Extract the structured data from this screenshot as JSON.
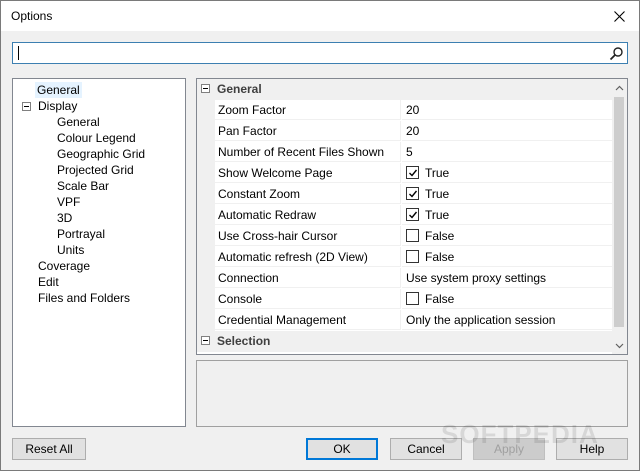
{
  "window": {
    "title": "Options"
  },
  "search": {
    "value": "",
    "placeholder": ""
  },
  "tree": {
    "items": [
      {
        "label": "General",
        "level": 1,
        "selected": true
      },
      {
        "label": "Display",
        "level": 0,
        "expanded": true
      },
      {
        "label": "General",
        "level": 2
      },
      {
        "label": "Colour Legend",
        "level": 2
      },
      {
        "label": "Geographic Grid",
        "level": 2
      },
      {
        "label": "Projected Grid",
        "level": 2
      },
      {
        "label": "Scale Bar",
        "level": 2
      },
      {
        "label": "VPF",
        "level": 2
      },
      {
        "label": "3D",
        "level": 2
      },
      {
        "label": "Portrayal",
        "level": 2
      },
      {
        "label": "Units",
        "level": 2
      },
      {
        "label": "Coverage",
        "level": 0
      },
      {
        "label": "Edit",
        "level": 0
      },
      {
        "label": "Files and Folders",
        "level": 0
      }
    ]
  },
  "grid": {
    "categories": [
      {
        "label": "General",
        "properties": [
          {
            "name": "Zoom Factor",
            "value": "20"
          },
          {
            "name": "Pan Factor",
            "value": "20"
          },
          {
            "name": "Number of Recent Files Shown",
            "value": "5"
          },
          {
            "name": "Show Welcome Page",
            "value": "True",
            "checked": true
          },
          {
            "name": "Constant Zoom",
            "value": "True",
            "checked": true
          },
          {
            "name": "Automatic Redraw",
            "value": "True",
            "checked": true
          },
          {
            "name": "Use Cross-hair Cursor",
            "value": "False",
            "checked": false
          },
          {
            "name": "Automatic refresh (2D View)",
            "value": "False",
            "checked": false
          },
          {
            "name": "Connection",
            "value": "Use system proxy settings"
          },
          {
            "name": "Console",
            "value": "False",
            "checked": false
          },
          {
            "name": "Credential Management",
            "value": "Only the application session"
          }
        ]
      },
      {
        "label": "Selection",
        "properties": []
      }
    ]
  },
  "buttons": {
    "reset_all": "Reset All",
    "ok": "OK",
    "cancel": "Cancel",
    "apply": "Apply",
    "help": "Help"
  },
  "watermark": "SOFTPEDIA"
}
